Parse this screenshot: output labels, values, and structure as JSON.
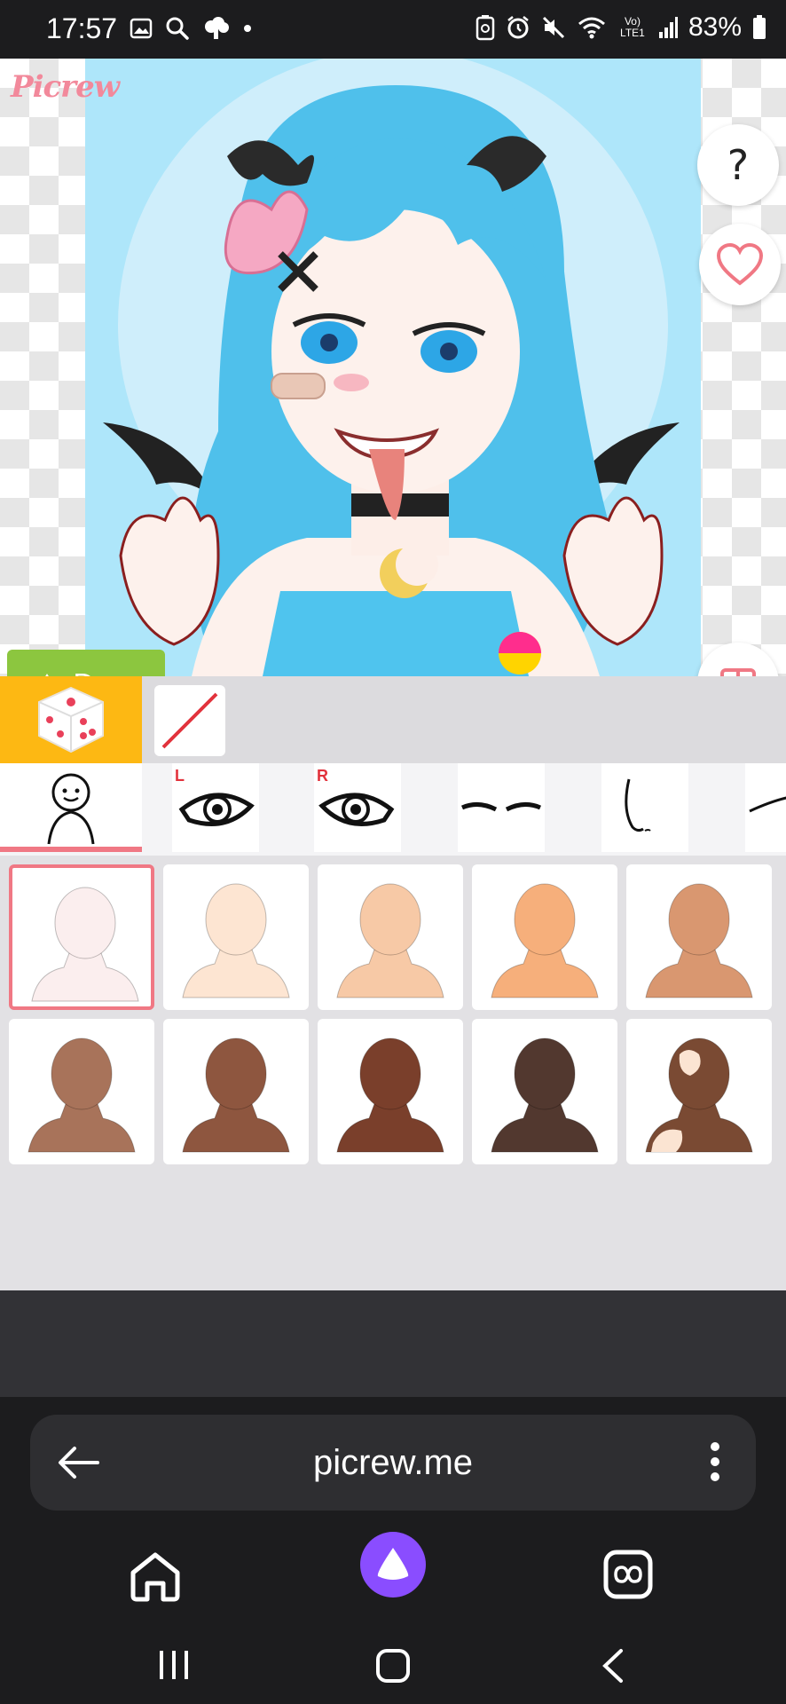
{
  "status_bar": {
    "time": "17:57",
    "battery": "83%",
    "left_icons": [
      "gallery-icon",
      "search-icon",
      "cloud-icon",
      "dot-icon"
    ],
    "right_icons": [
      "battery-saver-icon",
      "alarm-icon",
      "mute-icon",
      "wifi-icon",
      "volte-icon",
      "signal-icon",
      "battery-icon"
    ],
    "volte_label": "Vo) LTE1"
  },
  "app": {
    "logo": "Picrew",
    "done_label": "Done",
    "help_label": "?"
  },
  "tool_row": {
    "random_icon": "dice-icon",
    "none_icon": "none-slash-icon"
  },
  "categories": {
    "tabs": [
      {
        "name": "body",
        "icon": "body-icon"
      },
      {
        "name": "left-eye",
        "icon": "eye-icon",
        "tag": "L"
      },
      {
        "name": "right-eye",
        "icon": "eye-icon",
        "tag": "R"
      },
      {
        "name": "eyebrows",
        "icon": "eyebrows-icon"
      },
      {
        "name": "nose",
        "icon": "nose-icon"
      },
      {
        "name": "mouth",
        "icon": "mouth-icon"
      }
    ],
    "selected": 0
  },
  "skin_options": {
    "colors": [
      "#fbeeee",
      "#fde5d2",
      "#f7c9a6",
      "#f6af7b",
      "#d99770",
      "#a8735a",
      "#8e563f",
      "#7a3f2b",
      "#52382f",
      "#7a4a33"
    ],
    "selected": 0,
    "last_is_vitiligo": true
  },
  "browser": {
    "url": "picrew.me",
    "nav_icons": [
      "back-arrow-icon",
      "more-vert-icon",
      "home-icon",
      "alice-icon",
      "tabs-icon"
    ]
  },
  "system_nav": [
    "recents-icon",
    "home-icon",
    "back-icon"
  ],
  "colors": {
    "accent": "#f07884",
    "done": "#8cc63f",
    "dice_bg": "#fdb813",
    "portrait_bg": "#aee6fa",
    "hair": "#55c8ee"
  }
}
